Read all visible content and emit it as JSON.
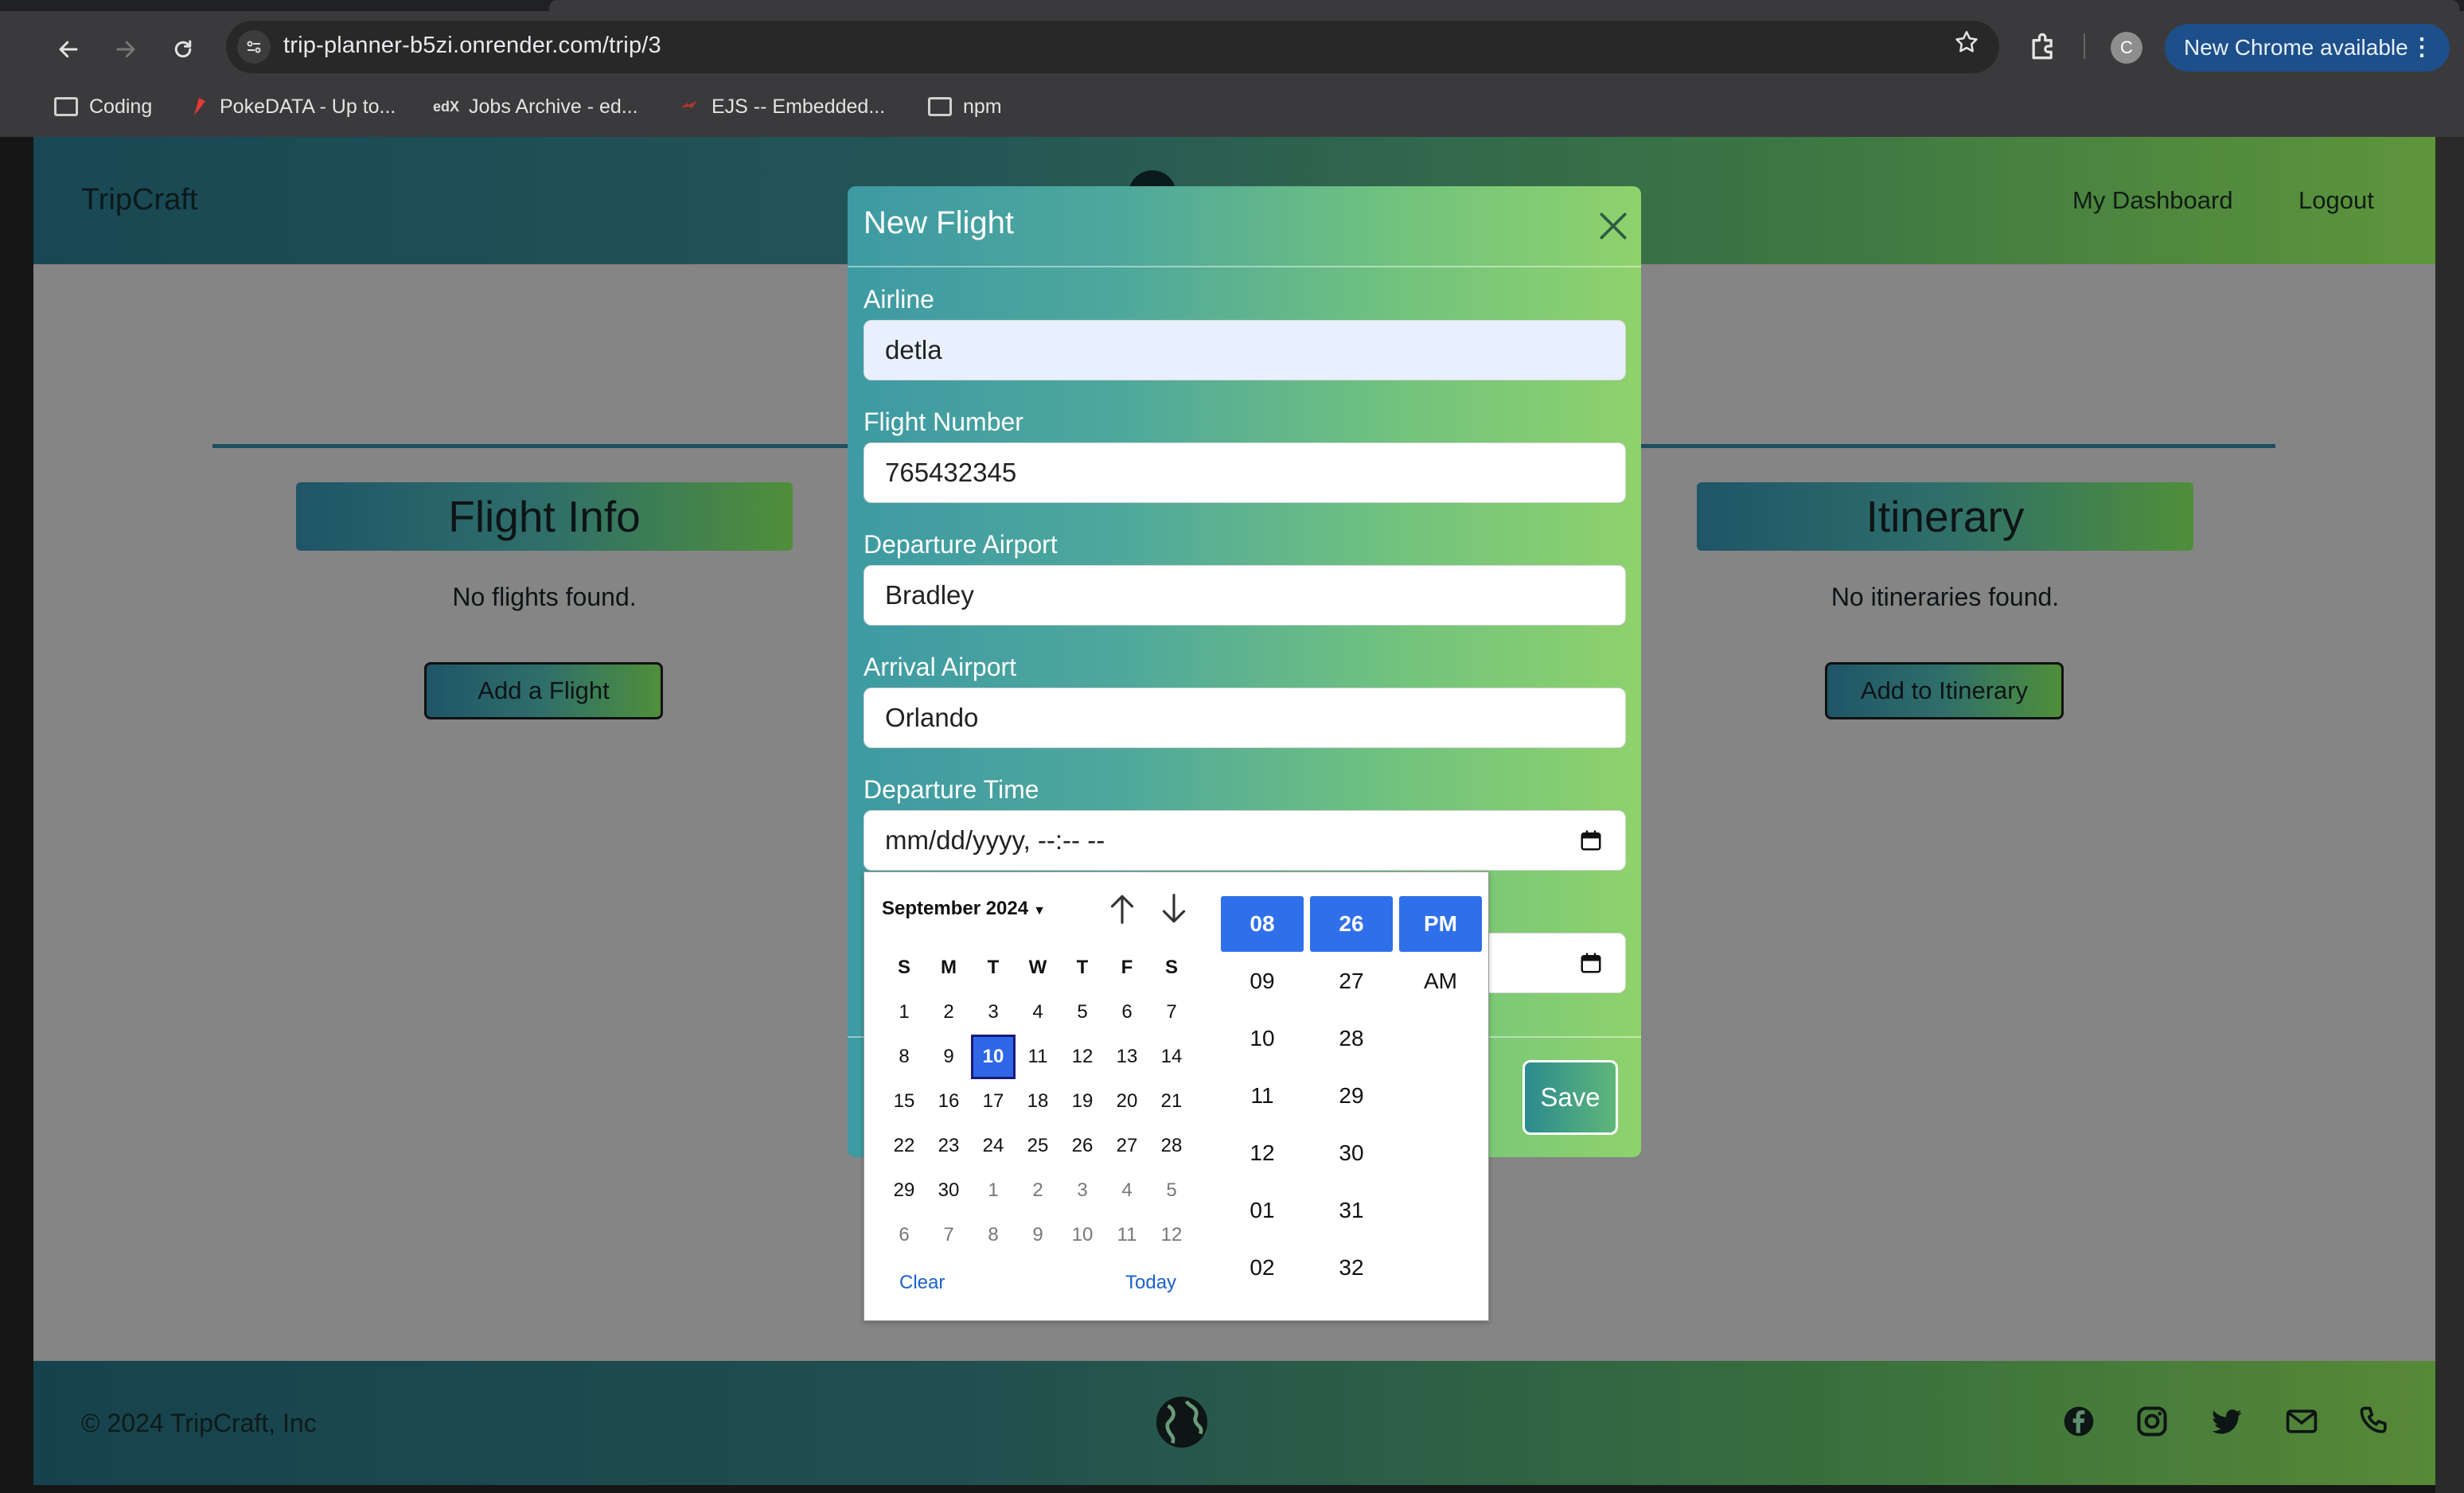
{
  "browser": {
    "url": "trip-planner-b5zi.onrender.com/trip/3",
    "profile_initial": "C",
    "update_label": "New Chrome available",
    "bookmarks": [
      {
        "label": "Coding",
        "icon": "folder-icon"
      },
      {
        "label": "PokeDATA - Up to...",
        "icon": "pokedata-favicon"
      },
      {
        "label": "Jobs Archive - ed...",
        "icon": "edx-favicon"
      },
      {
        "label": "EJS -- Embedded...",
        "icon": "ejs-favicon"
      },
      {
        "label": "npm",
        "icon": "folder-icon"
      }
    ]
  },
  "site": {
    "brand": "TripCraft",
    "nav": {
      "dashboard": "My Dashboard",
      "logout": "Logout"
    },
    "sections": [
      {
        "title": "Flight Info",
        "empty": "No flights found.",
        "button": "Add a Flight"
      },
      {
        "title": "Itinerary",
        "empty": "No itineraries found.",
        "button": "Add to Itinerary"
      }
    ],
    "footer": {
      "copyright": "© 2024 TripCraft, Inc",
      "social_icons": [
        "facebook-icon",
        "instagram-icon",
        "twitter-icon",
        "mail-icon",
        "phone-icon"
      ]
    }
  },
  "modal": {
    "title": "New Flight",
    "fields": {
      "airline": {
        "label": "Airline",
        "value": "detla"
      },
      "flight_number": {
        "label": "Flight Number",
        "value": "765432345"
      },
      "departure_airport": {
        "label": "Departure Airport",
        "value": "Bradley"
      },
      "arrival_airport": {
        "label": "Arrival Airport",
        "value": "Orlando"
      },
      "departure_time": {
        "label": "Departure Time",
        "value": "mm/dd/yyyy, --:-- --"
      }
    },
    "save_label": "Save"
  },
  "datepicker": {
    "month_label": "September 2024",
    "weekdays": [
      "S",
      "M",
      "T",
      "W",
      "T",
      "F",
      "S"
    ],
    "weeks": [
      [
        "1",
        "2",
        "3",
        "4",
        "5",
        "6",
        "7"
      ],
      [
        "8",
        "9",
        "10",
        "11",
        "12",
        "13",
        "14"
      ],
      [
        "15",
        "16",
        "17",
        "18",
        "19",
        "20",
        "21"
      ],
      [
        "22",
        "23",
        "24",
        "25",
        "26",
        "27",
        "28"
      ],
      [
        "29",
        "30",
        "1",
        "2",
        "3",
        "4",
        "5"
      ],
      [
        "6",
        "7",
        "8",
        "9",
        "10",
        "11",
        "12"
      ]
    ],
    "selected_day": "10",
    "clear_label": "Clear",
    "today_label": "Today",
    "hours": [
      "08",
      "09",
      "10",
      "11",
      "12",
      "01",
      "02"
    ],
    "minutes": [
      "26",
      "27",
      "28",
      "29",
      "30",
      "31",
      "32"
    ],
    "meridiem": [
      "PM",
      "AM"
    ],
    "selected": {
      "hour": "08",
      "minute": "26",
      "meridiem": "PM"
    },
    "accent_color": "#2f6fea"
  }
}
